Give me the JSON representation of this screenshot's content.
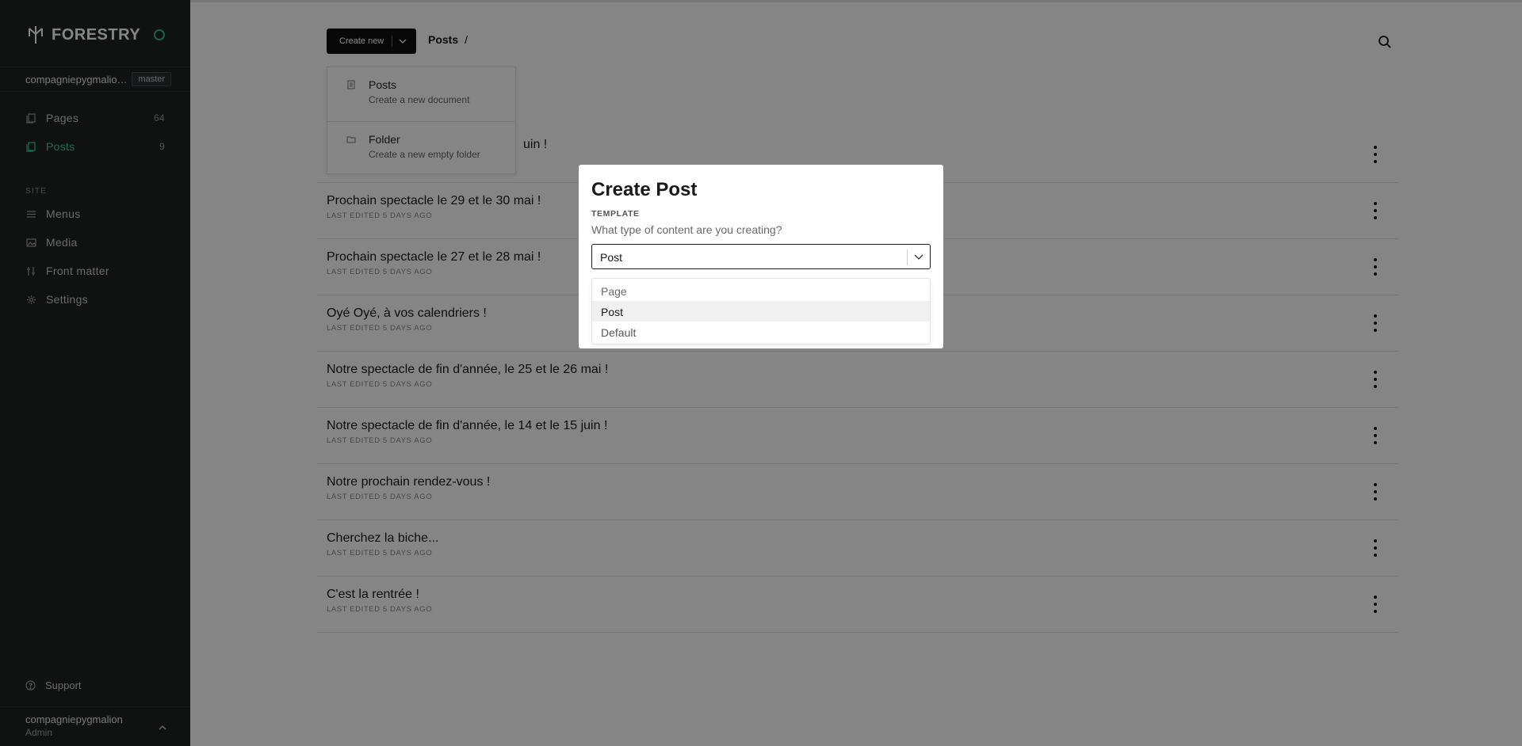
{
  "app": {
    "brand": "FORESTRY"
  },
  "repo": {
    "name": "compagniepygmalion...",
    "branch": "master"
  },
  "sidebar": {
    "items": [
      {
        "label": "Pages",
        "count": "64",
        "icon": "pages-icon"
      },
      {
        "label": "Posts",
        "count": "9",
        "icon": "posts-icon"
      }
    ],
    "section_label": "SITE",
    "site_items": [
      {
        "label": "Menus",
        "icon": "menu-icon"
      },
      {
        "label": "Media",
        "icon": "image-icon"
      },
      {
        "label": "Front matter",
        "icon": "sliders-icon"
      },
      {
        "label": "Settings",
        "icon": "gear-icon"
      }
    ],
    "support_label": "Support",
    "user": {
      "name": "compagniepygmalion",
      "role": "Admin"
    }
  },
  "header": {
    "create_label": "Create new",
    "breadcrumb": "Posts",
    "breadcrumb_sep": "/"
  },
  "create_menu": [
    {
      "label": "Posts",
      "desc": "Create a new document"
    },
    {
      "label": "Folder",
      "desc": "Create a new empty folder"
    }
  ],
  "posts": [
    {
      "title": "uin !",
      "meta": ""
    },
    {
      "title": "Prochain spectacle le 29 et le 30 mai !",
      "meta": "LAST EDITED 5 DAYS AGO"
    },
    {
      "title": "Prochain spectacle le 27 et le 28 mai !",
      "meta": "LAST EDITED 5 DAYS AGO"
    },
    {
      "title": "Oyé Oyé, à vos calendriers !",
      "meta": "LAST EDITED 5 DAYS AGO"
    },
    {
      "title": "Notre spectacle de fin d'année, le 25 et le 26 mai !",
      "meta": "LAST EDITED 5 DAYS AGO"
    },
    {
      "title": "Notre spectacle de fin d'année, le 14 et le 15 juin !",
      "meta": "LAST EDITED 5 DAYS AGO"
    },
    {
      "title": "Notre prochain rendez-vous !",
      "meta": "LAST EDITED 5 DAYS AGO"
    },
    {
      "title": "Cherchez la biche...",
      "meta": "LAST EDITED 5 DAYS AGO"
    },
    {
      "title": "C'est la rentrée !",
      "meta": "LAST EDITED 5 DAYS AGO"
    }
  ],
  "modal": {
    "title": "Create Post",
    "field_label": "TEMPLATE",
    "field_help": "What type of content are you creating?",
    "selected": "Post",
    "options": [
      "Page",
      "Post",
      "Default"
    ]
  },
  "colors": {
    "accent": "#35d39a",
    "sidebar_bg": "#1f2323",
    "overlay": "rgba(0,0,0,0.48)"
  }
}
